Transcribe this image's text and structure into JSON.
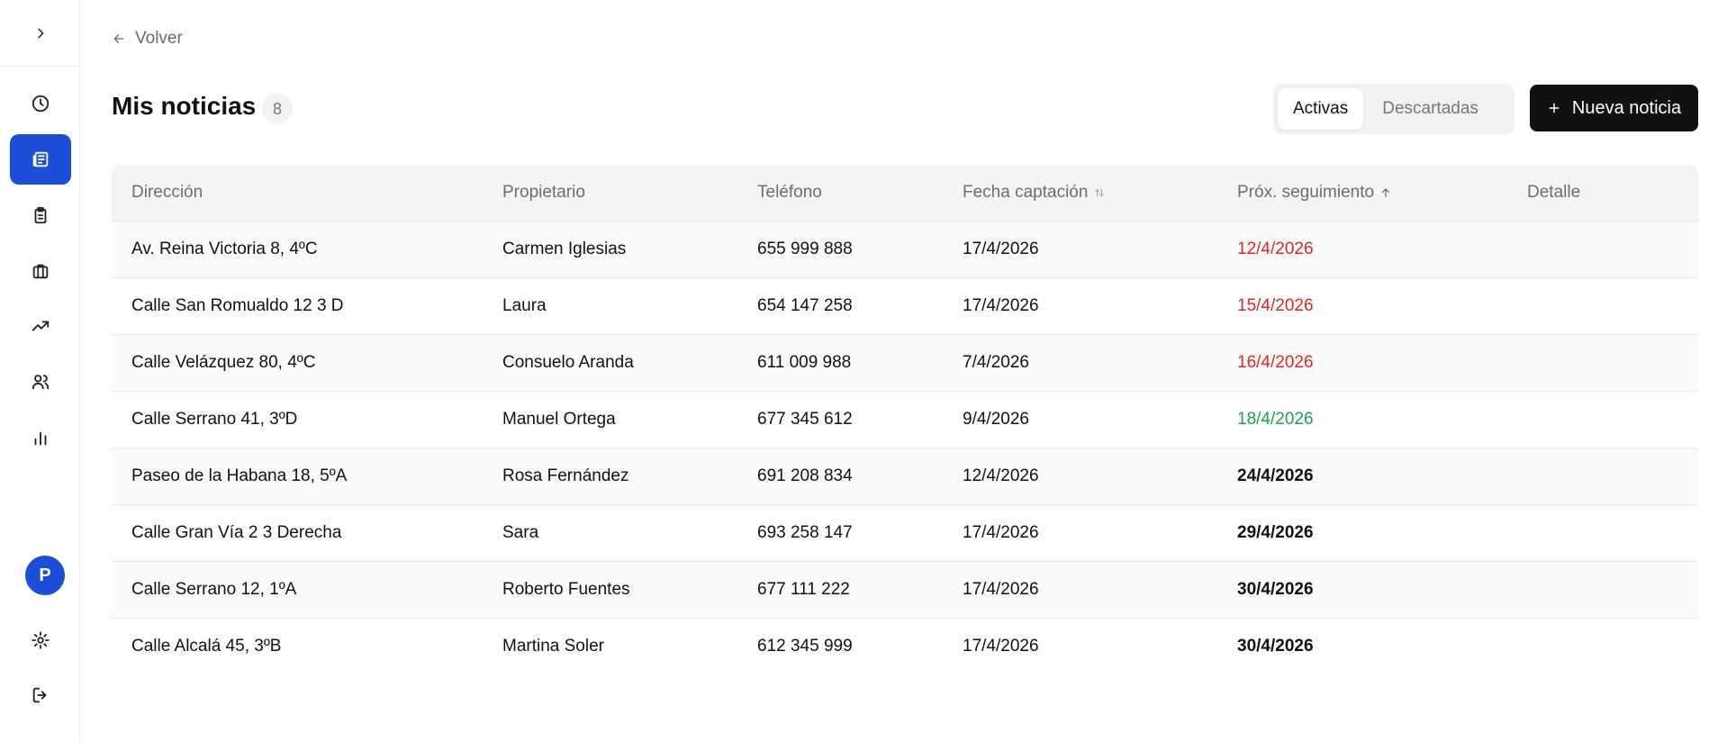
{
  "nav": {
    "back_label": "Volver"
  },
  "header": {
    "title": "Mis noticias",
    "count": "8"
  },
  "segments": [
    {
      "label": "Activas",
      "active": true
    },
    {
      "label": "Descartadas",
      "active": false
    }
  ],
  "new_button_label": "Nueva noticia",
  "sidebar": {
    "avatar_initial": "P",
    "items": [
      {
        "icon": "clock-icon",
        "active": false
      },
      {
        "icon": "newspaper-icon",
        "active": true
      },
      {
        "icon": "clipboard-icon",
        "active": false
      },
      {
        "icon": "briefcase-icon",
        "active": false
      },
      {
        "icon": "trending-up-icon",
        "active": false
      },
      {
        "icon": "users-icon",
        "active": false
      },
      {
        "icon": "bar-chart-icon",
        "active": false
      }
    ],
    "bottom": [
      {
        "icon": "gear-icon"
      },
      {
        "icon": "logout-icon"
      }
    ]
  },
  "table": {
    "columns": [
      "Dirección",
      "Propietario",
      "Teléfono",
      "Fecha captación",
      "Próx. seguimiento",
      "Detalle"
    ],
    "rows": [
      {
        "direccion": "Av. Reina Victoria 8, 4ºC",
        "propietario": "Carmen Iglesias",
        "telefono": "655 999 888",
        "fecha": "17/4/2026",
        "seguimiento": "12/4/2026",
        "status": "overdue"
      },
      {
        "direccion": "Calle San Romualdo 12 3 D",
        "propietario": "Laura",
        "telefono": "654 147 258",
        "fecha": "17/4/2026",
        "seguimiento": "15/4/2026",
        "status": "overdue"
      },
      {
        "direccion": "Calle Velázquez 80, 4ºC",
        "propietario": "Consuelo Aranda",
        "telefono": "611 009 988",
        "fecha": "7/4/2026",
        "seguimiento": "16/4/2026",
        "status": "overdue"
      },
      {
        "direccion": "Calle Serrano 41, 3ºD",
        "propietario": "Manuel Ortega",
        "telefono": "677 345 612",
        "fecha": "9/4/2026",
        "seguimiento": "18/4/2026",
        "status": "ok"
      },
      {
        "direccion": "Paseo de la Habana 18, 5ºA",
        "propietario": "Rosa Fernández",
        "telefono": "691 208 834",
        "fecha": "12/4/2026",
        "seguimiento": "24/4/2026",
        "status": "future"
      },
      {
        "direccion": "Calle Gran Vía 2 3 Derecha",
        "propietario": "Sara",
        "telefono": "693 258 147",
        "fecha": "17/4/2026",
        "seguimiento": "29/4/2026",
        "status": "future"
      },
      {
        "direccion": "Calle Serrano 12, 1ºA",
        "propietario": "Roberto Fuentes",
        "telefono": "677 111 222",
        "fecha": "17/4/2026",
        "seguimiento": "30/4/2026",
        "status": "future"
      },
      {
        "direccion": "Calle Alcalá 45, 3ºB",
        "propietario": "Martina Soler",
        "telefono": "612 345 999",
        "fecha": "17/4/2026",
        "seguimiento": "30/4/2026",
        "status": "future"
      }
    ]
  },
  "colors": {
    "accent": "#1d4ed8",
    "overdue": "#dc2626",
    "ok": "#16a34a"
  }
}
